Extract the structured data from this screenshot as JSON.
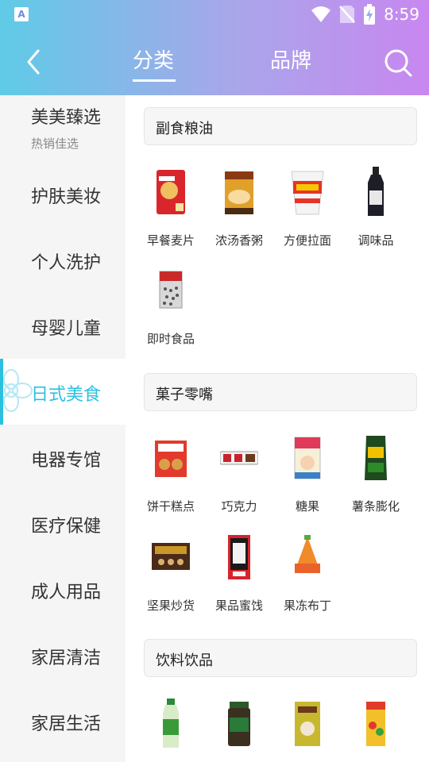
{
  "status": {
    "time": "8:59",
    "app_icon": "A"
  },
  "header": {
    "tabs": [
      "分类",
      "品牌"
    ],
    "active_tab": "分类"
  },
  "sidebar": {
    "items": [
      {
        "label": "美美臻选",
        "sub": "热销佳选"
      },
      {
        "label": "护肤美妆"
      },
      {
        "label": "个人洗护"
      },
      {
        "label": "母婴儿童"
      },
      {
        "label": "日式美食",
        "active": true
      },
      {
        "label": "电器专馆"
      },
      {
        "label": "医疗保健"
      },
      {
        "label": "成人用品"
      },
      {
        "label": "家居清洁"
      },
      {
        "label": "家居生活"
      }
    ]
  },
  "sections": [
    {
      "title": "副食粮油",
      "items": [
        "早餐麦片",
        "浓汤香粥",
        "方便拉面",
        "调味品",
        "即时食品"
      ]
    },
    {
      "title": "菓子零嘴",
      "items": [
        "饼干糕点",
        "巧克力",
        "糖果",
        "薯条膨化",
        "坚果炒货",
        "果品蜜饯",
        "果冻布丁"
      ]
    },
    {
      "title": "饮料饮品",
      "items": [
        "",
        "",
        "",
        ""
      ]
    }
  ],
  "colors": {
    "accent": "#2cc0e0",
    "gradient_start": "#5fcbe7",
    "gradient_end": "#c887f0"
  }
}
